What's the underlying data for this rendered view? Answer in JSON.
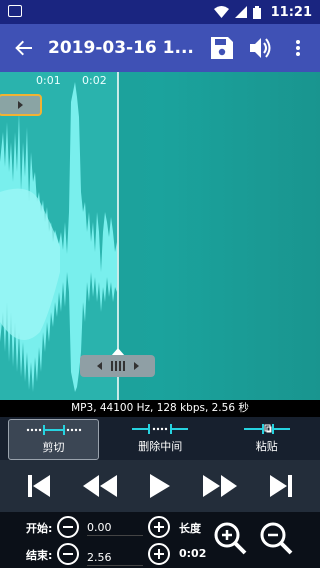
{
  "status_bar": {
    "time": "11:21"
  },
  "toolbar": {
    "title": "2019-03-16 1..."
  },
  "waveform": {
    "time_marks": [
      "0:01",
      "0:02"
    ]
  },
  "info": {
    "text": "MP3, 44100 Hz, 128 kbps, 2.56 秒"
  },
  "edit_buttons": [
    {
      "label": "剪切",
      "active": true
    },
    {
      "label": "删除中间",
      "active": false
    },
    {
      "label": "粘贴",
      "active": false
    }
  ],
  "range": {
    "start_label": "开始:",
    "start_value": "0.00",
    "end_label": "结束:",
    "end_value": "2.56",
    "length_label": "长度",
    "length_value": "0:02"
  },
  "colors": {
    "toolbar": "#3f51b5",
    "status_bar": "#1a2580",
    "wave": "#7df2f0",
    "accent": "#27d3e0",
    "handle_border": "#f2b233"
  }
}
